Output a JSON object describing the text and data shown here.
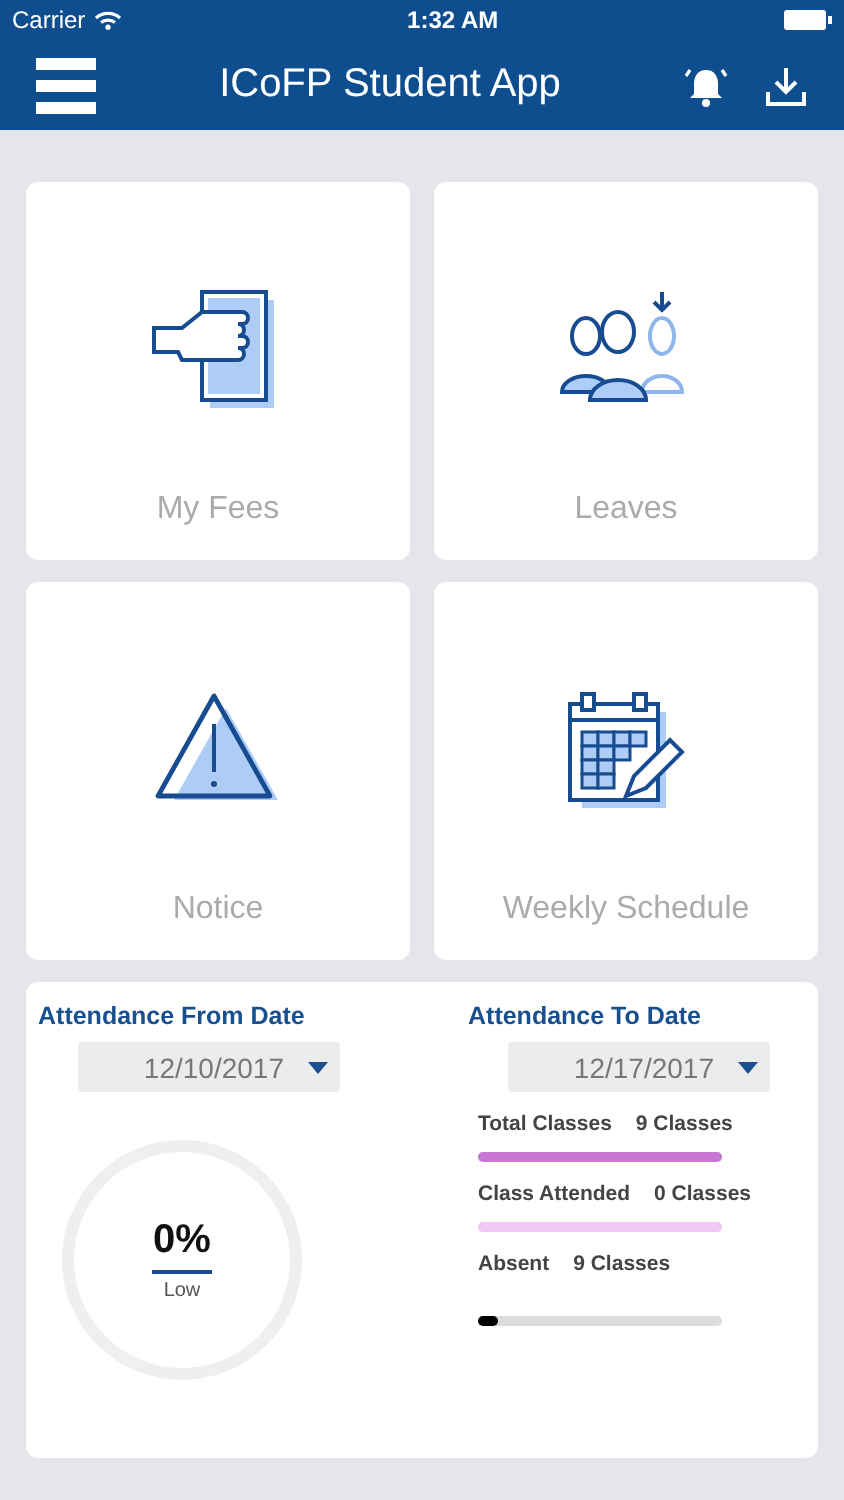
{
  "status_bar": {
    "carrier": "Carrier",
    "time": "1:32 AM"
  },
  "header": {
    "title": "ICoFP Student App"
  },
  "tiles": [
    {
      "kind": "fees",
      "label": "My Fees"
    },
    {
      "kind": "leaves",
      "label": "Leaves"
    },
    {
      "kind": "notice",
      "label": "Notice"
    },
    {
      "kind": "schedule",
      "label": "Weekly Schedule"
    }
  ],
  "attendance": {
    "from": {
      "label": "Attendance From Date",
      "value": "12/10/2017"
    },
    "to": {
      "label": "Attendance To Date",
      "value": "12/17/2017"
    },
    "gauge": {
      "reading": "0%",
      "rating": "Low"
    },
    "stats": [
      {
        "label": "Total Classes",
        "value": "9 Classes",
        "level": 1,
        "color": "#c878d2"
      },
      {
        "label": "Class Attended",
        "value": "0 Classes",
        "level": 1,
        "color": "#f2c8f4"
      },
      {
        "label": "Absent",
        "value": "9 Classes",
        "level": 0.08,
        "color": "#000000"
      }
    ]
  }
}
